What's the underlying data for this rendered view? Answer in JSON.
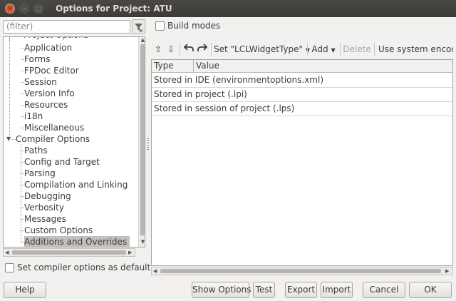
{
  "window": {
    "title": "Options for Project: ATU"
  },
  "filter": {
    "placeholder": "(filter)"
  },
  "tree": {
    "items": [
      {
        "label": "Application",
        "level": 1
      },
      {
        "label": "Forms",
        "level": 1
      },
      {
        "label": "FPDoc Editor",
        "level": 1
      },
      {
        "label": "Session",
        "level": 1
      },
      {
        "label": "Version Info",
        "level": 1
      },
      {
        "label": "Resources",
        "level": 1
      },
      {
        "label": "i18n",
        "level": 1
      },
      {
        "label": "Miscellaneous",
        "level": 1
      },
      {
        "label": "Compiler Options",
        "level": 0,
        "expanded": true
      },
      {
        "label": "Paths",
        "level": 1
      },
      {
        "label": "Config and Target",
        "level": 1
      },
      {
        "label": "Parsing",
        "level": 1
      },
      {
        "label": "Compilation and Linking",
        "level": 1
      },
      {
        "label": "Debugging",
        "level": 1
      },
      {
        "label": "Verbosity",
        "level": 1
      },
      {
        "label": "Messages",
        "level": 1
      },
      {
        "label": "Custom Options",
        "level": 1
      },
      {
        "label": "Additions and Overrides",
        "level": 1,
        "selected": true
      }
    ]
  },
  "build_modes": {
    "label": "Build modes",
    "checked": false
  },
  "toolbar": {
    "set_label": "Set \"LCLWidgetType\"",
    "add_label": "Add",
    "delete_label": "Delete",
    "encoding_label": "Use system encodin"
  },
  "grid": {
    "columns": [
      "Type",
      "Value"
    ],
    "rows": [
      "Stored in IDE (environmentoptions.xml)",
      "Stored in project (.lpi)",
      "Stored in session of project (.lps)"
    ]
  },
  "compiler_default": {
    "label": "Set compiler options as default",
    "checked": false
  },
  "buttons": {
    "help": "Help",
    "show_options": "Show Options",
    "test": "Test",
    "export": "Export",
    "import": "Import",
    "cancel": "Cancel",
    "ok": "OK"
  },
  "colors": {
    "titlebar": "#3c3b37",
    "close_button": "#e0582d",
    "selection": "#c3c0bb",
    "background": "#f2f1f0"
  }
}
